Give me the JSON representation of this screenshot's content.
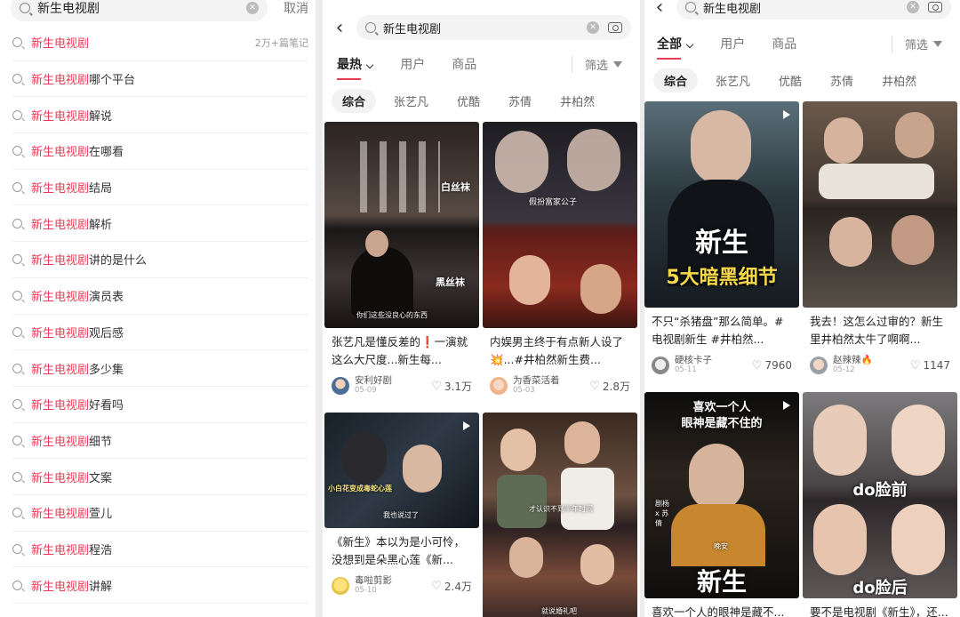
{
  "panel1": {
    "search_query": "新生电视剧",
    "cancel_label": "取消",
    "suggestions": [
      {
        "hl": "新生电视剧",
        "rest": "",
        "meta": "2万+篇笔记"
      },
      {
        "hl": "新生电视剧",
        "rest": "哪个平台",
        "meta": ""
      },
      {
        "hl": "新生电视剧",
        "rest": "解说",
        "meta": ""
      },
      {
        "hl": "新生电视剧",
        "rest": "在哪看",
        "meta": ""
      },
      {
        "hl": "新生电视剧",
        "rest": "结局",
        "meta": ""
      },
      {
        "hl": "新生电视剧",
        "rest": "解析",
        "meta": ""
      },
      {
        "hl": "新生电视剧",
        "rest": "讲的是什么",
        "meta": ""
      },
      {
        "hl": "新生电视剧",
        "rest": "演员表",
        "meta": ""
      },
      {
        "hl": "新生电视剧",
        "rest": "观后感",
        "meta": ""
      },
      {
        "hl": "新生电视剧",
        "rest": "多少集",
        "meta": ""
      },
      {
        "hl": "新生电视剧",
        "rest": "好看吗",
        "meta": ""
      },
      {
        "hl": "新生电视剧",
        "rest": "细节",
        "meta": ""
      },
      {
        "hl": "新生电视剧",
        "rest": "文案",
        "meta": ""
      },
      {
        "hl": "新生电视剧",
        "rest": "萱儿",
        "meta": ""
      },
      {
        "hl": "新生电视剧",
        "rest": "程浩",
        "meta": ""
      },
      {
        "hl": "新生电视剧",
        "rest": "讲解",
        "meta": ""
      }
    ]
  },
  "panel2": {
    "search_query": "新生电视剧",
    "tabs": [
      "最热",
      "用户",
      "商品"
    ],
    "filter_label": "筛选",
    "chips": [
      "综合",
      "张艺凡",
      "优酷",
      "苏倩",
      "井柏然"
    ],
    "cards": [
      {
        "title": "张艺凡是懂反差的❗一演就这么大尺度...新生每...",
        "user": "安利好剧",
        "date": "05-09",
        "likes": "3.1万",
        "cap1": "白丝袜",
        "cap2": "黑丝袜",
        "cap3": "你们这些没良心的东西"
      },
      {
        "title": "内娱男主终于有点新人设了💥...#井柏然新生费...",
        "user": "为香菜活着",
        "date": "05-03",
        "likes": "2.8万",
        "cap1": "假扮富家公子"
      },
      {
        "title": "《新生》本以为是小可怜，没想到是朵黑心莲《新...",
        "user": "毒啦剪影",
        "date": "05-10",
        "likes": "2.4万",
        "cap1": "小白花变成毒蛇心莲",
        "cap2": "我也说过了"
      },
      {
        "cap1": "才认识不到半年时间",
        "cap2": "就说婚礼吧"
      }
    ]
  },
  "panel3": {
    "search_query": "新生电视剧",
    "tabs": [
      "全部",
      "用户",
      "商品"
    ],
    "filter_label": "筛选",
    "chips": [
      "综合",
      "张艺凡",
      "优酷",
      "苏倩",
      "井柏然"
    ],
    "cards": [
      {
        "title": "不只“杀猪盘”那么简单。#电视剧新生 #井柏然...",
        "user": "硬核卡子",
        "date": "05-11",
        "likes": "7960",
        "big1": "新生",
        "big2": "5大暗黑细节"
      },
      {
        "title": "我去！这怎么过审的？新生里井柏然太牛了啊啊...",
        "user": "赵辣辣🔥",
        "date": "05-12",
        "likes": "1147"
      },
      {
        "title": "喜欢一个人的眼神是藏不...",
        "cap1": "喜欢一个人",
        "cap2": "眼神是藏不住的",
        "cap3": "剧杨 x 苏倩",
        "cap4": "晚安",
        "big1": "新生"
      },
      {
        "title": "要不是电视剧《新生》，还...",
        "cap1": "do脸前",
        "cap2": "do脸后"
      }
    ]
  }
}
